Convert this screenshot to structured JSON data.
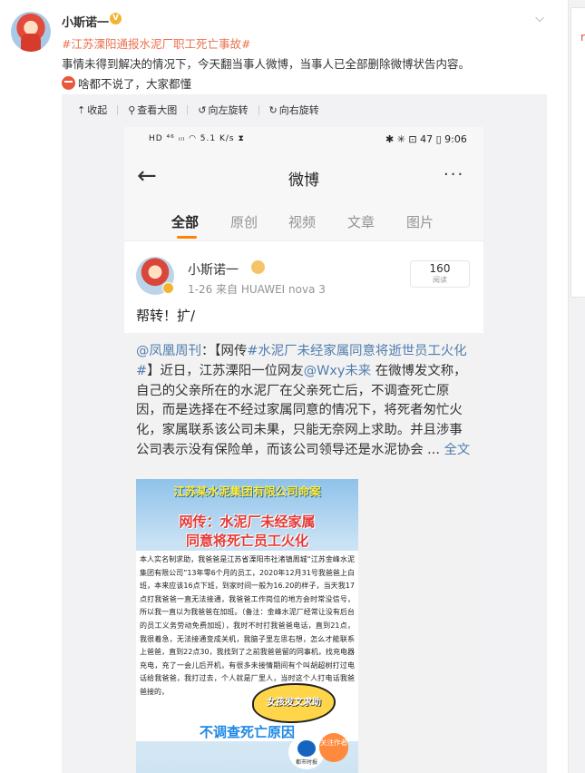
{
  "post": {
    "author": "小斯诺一",
    "verified_badge": "V",
    "expand_icon": "chevron-down-icon",
    "topic": "#江苏溧阳通报水泥厂职工死亡事故#",
    "text_line2": "事情未得到解决的情况下，今天翻当事人微博，当事人已全部删除微博状告内容。",
    "text_line3": "啥都不说了，大家都懂",
    "accent_color": "#eb7350"
  },
  "viewer_toolbar": {
    "collapse": "收起",
    "view_large": "查看大图",
    "rotate_left": "向左旋转",
    "rotate_right": "向右旋转"
  },
  "screenshot": {
    "status_left": "HD ⁴⁶ ᵢₗₗ ◠ 5.1 K/s ⧗",
    "status_right": "✱ ✳ ⊡ 47 ▯ 9:06",
    "nav_title": "微博",
    "back_icon": "arrow-left-icon",
    "more_icon": "more-dots-icon",
    "tabs": [
      "全部",
      "原创",
      "视频",
      "文章",
      "图片"
    ],
    "active_tab": 0,
    "user": {
      "name": "小斯诺一",
      "meta": "1-26   来自 HUAWEI nova 3",
      "read_count": "160",
      "read_label": "阅读",
      "text": "帮转！扩/"
    },
    "repost": {
      "mention": "@凤凰周刊",
      "prefix": "：【网传",
      "topic": "#水泥厂未经家属同意将逝世员工火化#",
      "body1": "】近日，江苏溧阳一位网友",
      "mention2": "@Wxy未来",
      "body2": " 在微博发文称，自己的父亲所在的水泥厂在父亲死亡后，不调查死亡原因，而是选择在不经过家属同意的情况下，将死者匆忙火化，家属联系该公司未果，只能无奈网上求助。并且涉事公司表示没有保险单，而该公司领导还是水泥协会 ... ",
      "more": "全文"
    },
    "poster": {
      "header": "江苏某水泥集团有限公司命案",
      "title1": "网传：水泥厂未经家属",
      "title2": "同意将死亡员工火化",
      "body": "本人实名制求助，我爸爸是江苏省溧阳市社渚镇周城“江苏金峰水泥集团有限公司”13年零6个月的员工，2020年12月31号我爸爸上白班，本来应该16点下班，到家时间一般为16.20的样子，当天我17点打我爸爸一直无法接通，我爸爸工作岗位的地方会时常没信号，所以我一直以为我爸爸在加班。（备注：金峰水泥厂经常让没有后台的员工义务劳动免费加班），我时不时打我爸爸电话，直到21点，我很着急，无法接通变成关机，我脑子里左思右想，怎么才能联系上爸爸，直到22点30，我找到了之前我爸爸留的同事机，找充电器充电，充了一会儿后开机，有很多未接情期间有个叫胡超树打过电话给我爸爸，我打过去，个人就是厂里人，当时这个人打电话我爸爸接的，",
      "burst": "女孩发文求助",
      "footer": "不调查死亡原因",
      "logo_text": "都市时报",
      "follow": "关注作者"
    }
  }
}
